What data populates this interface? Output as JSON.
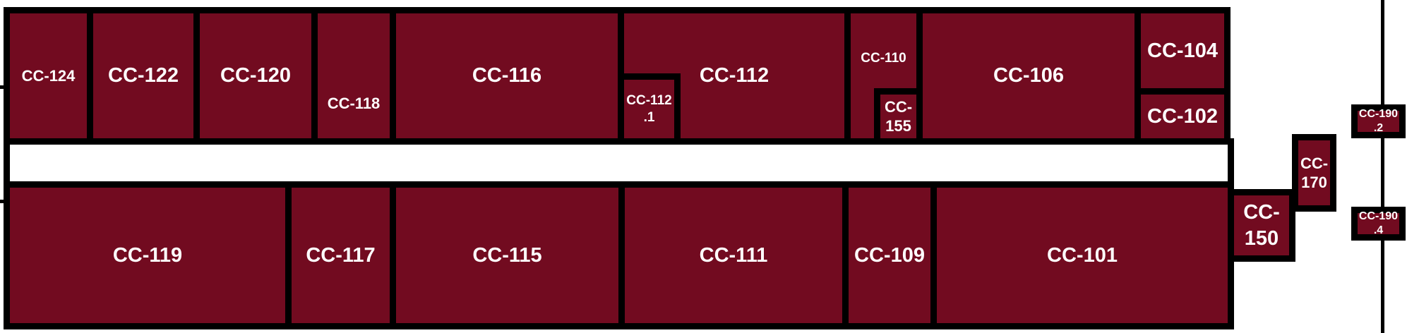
{
  "floor_plan": {
    "colors": {
      "room": "#720b20",
      "wall": "#000000",
      "corridor": "#ffffff",
      "label": "#ffffff"
    },
    "rooms": {
      "cc124": "CC-124",
      "cc122": "CC-122",
      "cc120": "CC-120",
      "cc118": "CC-118",
      "cc116": "CC-116",
      "cc112": "CC-112",
      "cc112_1": "CC-112\n.1",
      "cc110": "CC-110",
      "cc155": "CC-\n155",
      "cc106": "CC-106",
      "cc104": "CC-104",
      "cc102": "CC-102",
      "cc119": "CC-119",
      "cc117": "CC-117",
      "cc115": "CC-115",
      "cc111": "CC-111",
      "cc109": "CC-109",
      "cc101": "CC-101",
      "cc150": "CC-\n150",
      "cc170": "CC-\n170",
      "cc190_2": "CC-190\n.2",
      "cc190_4": "CC-190\n.4"
    }
  }
}
